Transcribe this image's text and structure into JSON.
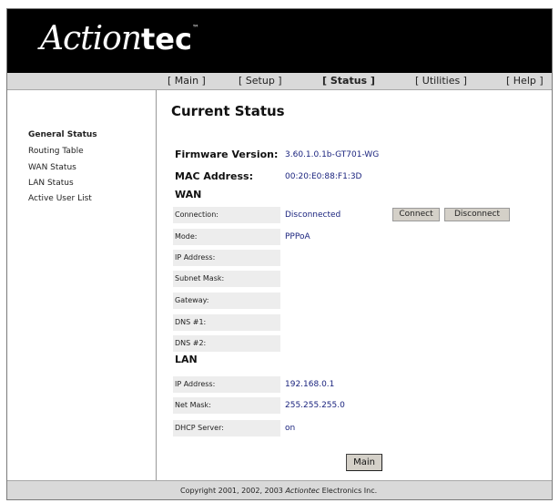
{
  "brand": {
    "logo_script": "Action",
    "logo_tec": "tec",
    "logo_tm": "™"
  },
  "nav": {
    "main": "[ Main ]",
    "setup": "[ Setup ]",
    "status": "[ Status ]",
    "utilities": "[ Utilities ]",
    "help": "[ Help ]"
  },
  "sidebar": {
    "items": [
      {
        "label": "General Status",
        "active": true
      },
      {
        "label": "Routing Table"
      },
      {
        "label": "WAN Status"
      },
      {
        "label": "LAN Status"
      },
      {
        "label": "Active User List"
      }
    ]
  },
  "page": {
    "title": "Current Status",
    "firmware_label": "Firmware Version:",
    "firmware_value": "3.60.1.0.1b-GT701-WG",
    "mac_label": "MAC Address:",
    "mac_value": "00:20:E0:88:F1:3D"
  },
  "wan": {
    "heading": "WAN",
    "connection_label": "Connection:",
    "connection_value": "Disconnected",
    "connect_button": "Connect",
    "disconnect_button": "Disconnect",
    "mode_label": "Mode:",
    "mode_value": "PPPoA",
    "ip_label": "IP Address:",
    "ip_value": "",
    "subnet_label": "Subnet Mask:",
    "subnet_value": "",
    "gateway_label": "Gateway:",
    "gateway_value": "",
    "dns1_label": "DNS #1:",
    "dns1_value": "",
    "dns2_label": "DNS #2:",
    "dns2_value": ""
  },
  "lan": {
    "heading": "LAN",
    "ip_label": "IP Address:",
    "ip_value": "192.168.0.1",
    "netmask_label": "Net Mask:",
    "netmask_value": "255.255.255.0",
    "dhcp_label": "DHCP Server:",
    "dhcp_value": "on"
  },
  "main_button": "Main",
  "footer": {
    "copyright_prefix": "Copyright 2001, 2002, 2003 ",
    "brand": "Actiontec",
    "copyright_suffix": " Electronics Inc."
  }
}
